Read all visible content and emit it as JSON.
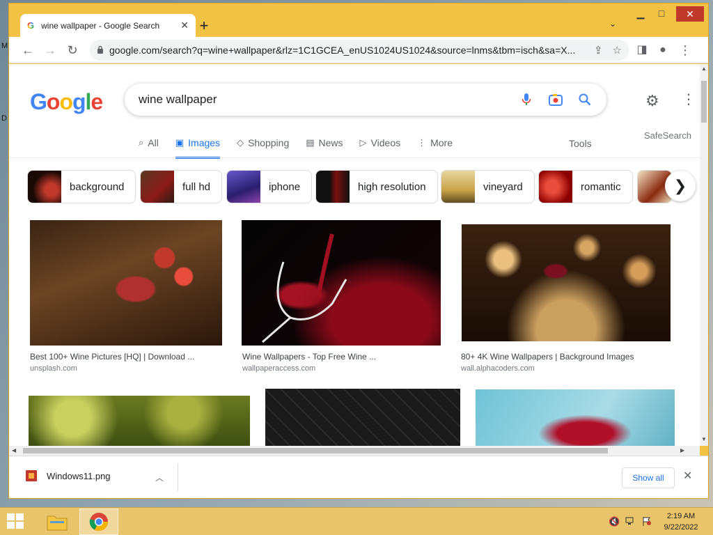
{
  "desktop": {
    "label_m": "M",
    "label_d": "D"
  },
  "browser": {
    "tab": {
      "favicon": "G",
      "title": "wine wallpaper - Google Search",
      "close": "✕"
    },
    "new_tab": "+",
    "tab_search": "⌄",
    "window_controls": {
      "minimize": "▁",
      "maximize": "□",
      "close": "✕"
    },
    "nav": {
      "back": "←",
      "forward": "→",
      "reload": "↻"
    },
    "url": "google.com/search?q=wine+wallpaper&rlz=1C1GCEA_enUS1024US1024&source=lnms&tbm=isch&sa=X...",
    "omnibox_icons": {
      "share": "⇪",
      "bookmark": "☆"
    },
    "side_panel": "◨",
    "profile": "●",
    "menu": "⋮"
  },
  "google": {
    "logo": [
      "G",
      "o",
      "o",
      "g",
      "l",
      "e"
    ],
    "query": "wine wallpaper",
    "settings_icon": "⚙",
    "apps_icon": "⋮⋮",
    "safesearch": "SafeSearch",
    "tabs": [
      {
        "label": "All",
        "icon": "⌕"
      },
      {
        "label": "Images",
        "icon": "▣"
      },
      {
        "label": "Shopping",
        "icon": "◇"
      },
      {
        "label": "News",
        "icon": "▤"
      },
      {
        "label": "Videos",
        "icon": "▷"
      },
      {
        "label": "More",
        "icon": "⋮"
      }
    ],
    "tools": "Tools",
    "chips": [
      {
        "label": "background"
      },
      {
        "label": "full hd"
      },
      {
        "label": "iphone"
      },
      {
        "label": "high resolution"
      },
      {
        "label": "vineyard"
      },
      {
        "label": "romantic"
      }
    ],
    "chip_next": "❯",
    "results": [
      {
        "title": "Best 100+ Wine Pictures [HQ] | Download ...",
        "source": "unsplash.com"
      },
      {
        "title": "Wine Wallpapers - Top Free Wine ...",
        "source": "wallpaperaccess.com"
      },
      {
        "title": "80+ 4K Wine Wallpapers | Background Images",
        "source": "wall.alphacoders.com"
      }
    ]
  },
  "downloads": {
    "file": "Windows11.png",
    "chevron": "︿",
    "show_all": "Show all",
    "close": "✕"
  },
  "taskbar": {
    "time": "2:19 AM",
    "date": "9/22/2022"
  }
}
